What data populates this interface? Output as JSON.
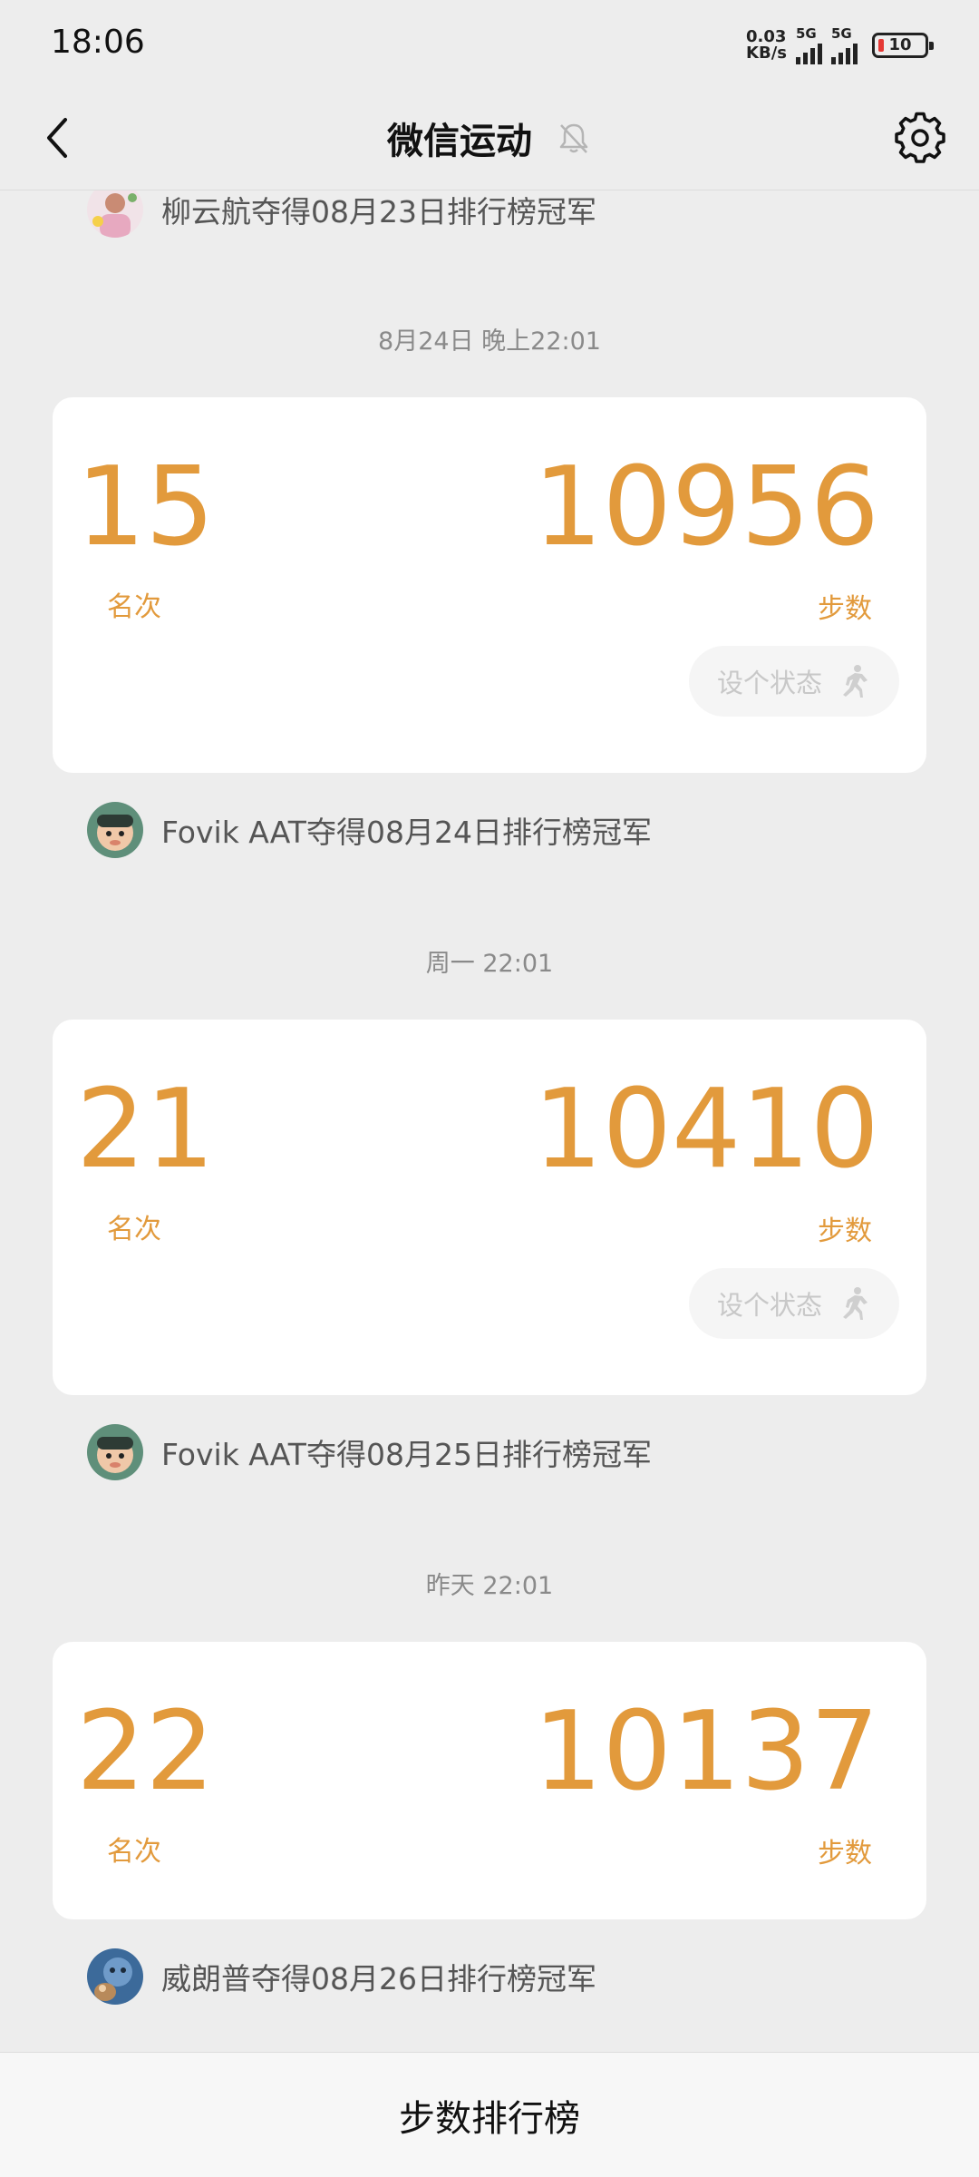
{
  "status_bar": {
    "time": "18:06",
    "net_speed_value": "0.03",
    "net_speed_unit": "KB/s",
    "sim1_label": "5G",
    "sim2_label": "5G",
    "battery_level": "10"
  },
  "nav": {
    "title": "微信运动"
  },
  "feed": {
    "top_champion": "柳云航夺得08月23日排行榜冠军",
    "entries": [
      {
        "timestamp": "8月24日 晚上22:01",
        "rank": "15",
        "rank_label": "名次",
        "steps": "10956",
        "steps_label": "步数",
        "status_button": "设个状态",
        "champion": "Fovik AAT夺得08月24日排行榜冠军"
      },
      {
        "timestamp": "周一 22:01",
        "rank": "21",
        "rank_label": "名次",
        "steps": "10410",
        "steps_label": "步数",
        "status_button": "设个状态",
        "champion": "Fovik AAT夺得08月25日排行榜冠军"
      },
      {
        "timestamp": "昨天 22:01",
        "rank": "22",
        "rank_label": "名次",
        "steps": "10137",
        "steps_label": "步数",
        "champion": "威朗普夺得08月26日排行榜冠军"
      }
    ]
  },
  "bottom_bar": {
    "label": "步数排行榜"
  },
  "colors": {
    "accent": "#e29a3c",
    "background": "#ededed",
    "card": "#ffffff"
  }
}
